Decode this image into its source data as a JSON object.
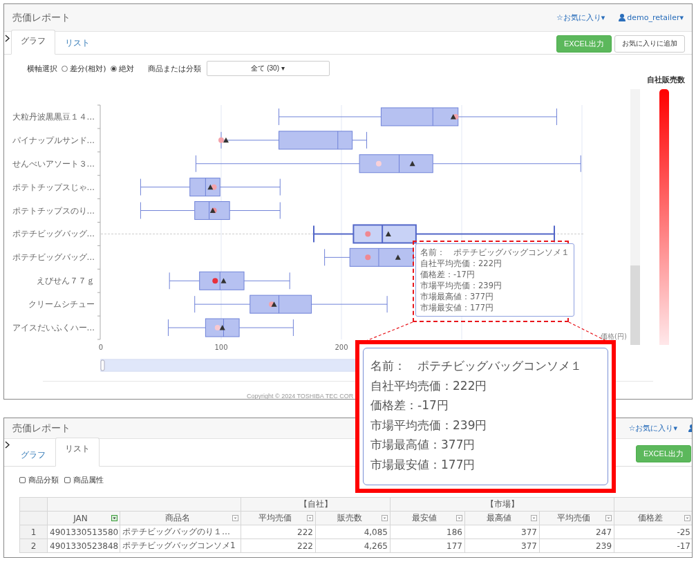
{
  "report_panel": {
    "title": "売価レポート",
    "favorites_menu": "☆お気に入り▾",
    "user_menu": "demo_retailer▾",
    "tabs": [
      {
        "label": "グラフ",
        "selected": true
      },
      {
        "label": "リスト",
        "selected": false
      }
    ],
    "buttons": [
      {
        "label": "EXCEL出力",
        "kind": "primary"
      },
      {
        "label": "お気に入りに追加",
        "kind": "default"
      }
    ],
    "axis_select": {
      "label": "横軸選択",
      "options": [
        {
          "label": "差分(相対)",
          "selected": false
        },
        {
          "label": "絶対",
          "selected": true
        }
      ]
    },
    "filter": {
      "label": "商品または分類",
      "value": "全て (30) ▾"
    },
    "chart": {
      "categories": [
        "大粒丹波黒黒豆１４…",
        "パイナップルサンド…",
        "せんべいアソート３…",
        "ポテトチップスじゃ…",
        "ポテトチップスのり…",
        "ポテチビッグバッグ…",
        "ポテチビッグバッグ…",
        "えびせん７７ｇ",
        "クリームシチュー",
        "アイスだいふくハー…"
      ],
      "x_tick_labels": [
        "0",
        "100",
        "200"
      ],
      "x_axis_title": "価格(円)",
      "range_slider": {
        "level": 1
      },
      "rows": [
        {
          "color": "#f4a3ab",
          "hovered": false
        },
        {
          "color": "#f4a3ab",
          "hovered": false
        },
        {
          "color": "#f9d0d8",
          "hovered": false
        },
        {
          "color": "#f4a3ab",
          "hovered": false
        },
        {
          "color": "#f08c95",
          "hovered": false
        },
        {
          "color": "#f08891",
          "hovered": true
        },
        {
          "color": "#f08891",
          "hovered": false
        },
        {
          "color": "#e8303c",
          "hovered": false
        },
        {
          "color": "#f4a3ab",
          "hovered": false
        },
        {
          "color": "#f8c8d0",
          "hovered": false
        }
      ],
      "tooltip": [
        "名前：　ポテチビッグバッグコンソメ１",
        "自社平均売価：222円",
        "価格差：-17円",
        "市場平均売価：239円",
        "市場最高値：377円",
        "市場最安値：177円"
      ]
    },
    "legend_title": "自社販売数",
    "copyright": "Copyright © 2024 TOSHIBA TEC COR"
  },
  "list_panel": {
    "title": "売価レポート",
    "favorites_menu": "☆お気に入り▾",
    "tabs": [
      {
        "label": "グラフ",
        "selected": false
      },
      {
        "label": "リスト",
        "selected": true
      }
    ],
    "buttons": [
      {
        "label": "EXCEL出力",
        "kind": "primary"
      }
    ],
    "checkboxes": [
      {
        "label": "商品分類",
        "checked": false
      },
      {
        "label": "商品属性",
        "checked": false
      }
    ],
    "table": {
      "column_groups": [
        {
          "columns": [
            {
              "label": "JAN",
              "filter_active": true
            },
            {
              "label": "商品名",
              "filter_active": false
            }
          ]
        },
        {
          "label": "【自社】",
          "columns": [
            {
              "label": "平均売価",
              "filter_active": false
            },
            {
              "label": "販売数",
              "filter_active": false
            }
          ]
        },
        {
          "label": "【市場】",
          "columns": [
            {
              "label": "最安値",
              "filter_active": false
            },
            {
              "label": "最高値",
              "filter_active": false
            },
            {
              "label": "平均売価",
              "filter_active": false
            }
          ]
        },
        {
          "columns": [
            {
              "label": "価格差",
              "filter_active": false
            }
          ]
        }
      ],
      "rows": [
        {
          "number": "1",
          "cells": [
            "4901330513580",
            "ポテチビッグバッグのり１…",
            "222",
            "4,085",
            "186",
            "377",
            "247",
            "-25"
          ]
        },
        {
          "number": "2",
          "cells": [
            "4901330523848",
            "ポテチビッグバッグコンソメ1",
            "222",
            "4,265",
            "177",
            "377",
            "239",
            "-17"
          ]
        }
      ]
    }
  },
  "zoom_callout": [
    "名前：　ポテチビッグバッグコンソメ１",
    "自社平均売価：222円",
    "価格差：-17円",
    "市場平均売価：239円",
    "市場最高値：377円",
    "市場最安値：177円"
  ]
}
